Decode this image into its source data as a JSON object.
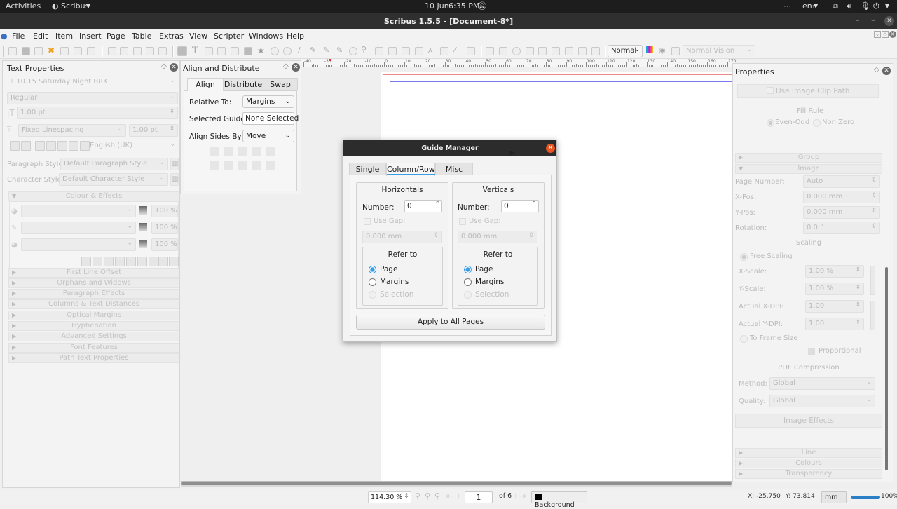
{
  "system_bar": {
    "activities": "Activities",
    "app_name": "Scribus",
    "date": "10 Jun",
    "time": "6:35 PM",
    "language": "en₁"
  },
  "window": {
    "title": "Scribus 1.5.5 - [Document-8*]"
  },
  "menu": [
    "File",
    "Edit",
    "Item",
    "Insert",
    "Page",
    "Table",
    "Extras",
    "View",
    "Scripter",
    "Windows",
    "Help"
  ],
  "toolbar": {
    "render_mode": "Normal",
    "vision_mode": "Normal Vision"
  },
  "text_properties": {
    "title": "Text Properties",
    "font": "10.15 Saturday Night BRK",
    "style": "Regular",
    "font_size": "1.00 pt",
    "linespacing_mode": "Fixed Linespacing",
    "linespacing_value": "1.00 pt",
    "language": "English (UK)",
    "paragraph_style_label": "Paragraph Style:",
    "paragraph_style": "Default Paragraph Style",
    "character_style_label": "Character Style:",
    "character_style": "Default Character Style",
    "colour_effects": "Colour & Effects",
    "colour_rows": [
      {
        "percent": "100 %"
      },
      {
        "percent": "100 %"
      },
      {
        "percent": "100 %"
      }
    ],
    "sections": [
      "First Line Offset",
      "Orphans and Widows",
      "Paragraph Effects",
      "Columns & Text Distances",
      "Optical Margins",
      "Hyphenation",
      "Advanced Settings",
      "Font Features",
      "Path Text Properties"
    ]
  },
  "align_distribute": {
    "title": "Align and Distribute",
    "tabs": [
      "Align",
      "Distribute",
      "Swap"
    ],
    "relative_to_label": "Relative To:",
    "relative_to": "Margins",
    "selected_guide_label": "Selected Guide:",
    "selected_guide": "None Selected",
    "align_sides_label": "Align Sides By:",
    "align_sides": "Move"
  },
  "guide_manager": {
    "title": "Guide Manager",
    "tabs": [
      "Single",
      "Column/Row",
      "Misc"
    ],
    "active_tab": "Column/Row",
    "horizontals": {
      "title": "Horizontals",
      "number_label": "Number:",
      "number": "0",
      "use_gap": "Use Gap:",
      "gap": "0.000 mm",
      "refer_to": "Refer to",
      "options": [
        "Page",
        "Margins",
        "Selection"
      ],
      "selected": "Page"
    },
    "verticals": {
      "title": "Verticals",
      "number_label": "Number:",
      "number": "0",
      "use_gap": "Use Gap:",
      "gap": "0.000 mm",
      "refer_to": "Refer to",
      "options": [
        "Page",
        "Margins",
        "Selection"
      ],
      "selected": "Page"
    },
    "apply_button": "Apply to All Pages"
  },
  "properties": {
    "title": "Properties",
    "use_clip_path": "Use Image Clip Path",
    "fill_rule": "Fill Rule",
    "fill_options": [
      "Even-Odd",
      "Non Zero"
    ],
    "group": "Group",
    "image": "Image",
    "page_number_label": "Page Number:",
    "page_number": "Auto",
    "xpos_label": "X-Pos:",
    "xpos": "0.000 mm",
    "ypos_label": "Y-Pos:",
    "ypos": "0.000 mm",
    "rotation_label": "Rotation:",
    "rotation": "0.0 °",
    "scaling": "Scaling",
    "free_scaling": "Free Scaling",
    "xscale_label": "X-Scale:",
    "xscale": "1.00 %",
    "yscale_label": "Y-Scale:",
    "yscale": "1.00 %",
    "xdpi_label": "Actual X-DPI:",
    "xdpi": "1.00",
    "ydpi_label": "Actual Y-DPI:",
    "ydpi": "1.00",
    "to_frame_size": "To Frame Size",
    "proportional": "Proportional",
    "pdf_compression": "PDF Compression",
    "method_label": "Method:",
    "method": "Global",
    "quality_label": "Quality:",
    "quality": "Global",
    "image_effects": "Image Effects",
    "sections": [
      "Line",
      "Colours",
      "Transparency"
    ]
  },
  "ruler": {
    "ticks": [
      "-40",
      "-30",
      "-20",
      "-10",
      "0",
      "10",
      "20",
      "30",
      "40",
      "50",
      "60",
      "70",
      "80",
      "90",
      "100",
      "110",
      "120",
      "130",
      "140",
      "150",
      "160",
      "170"
    ]
  },
  "status_bar": {
    "zoom": "114.30 %",
    "page": "1",
    "page_of": "of 6",
    "layer": "Background",
    "x_coord": "X: -25.750",
    "y_coord": "Y: 73.814",
    "unit": "mm",
    "progress_percent": 100,
    "progress_label": "100%"
  }
}
